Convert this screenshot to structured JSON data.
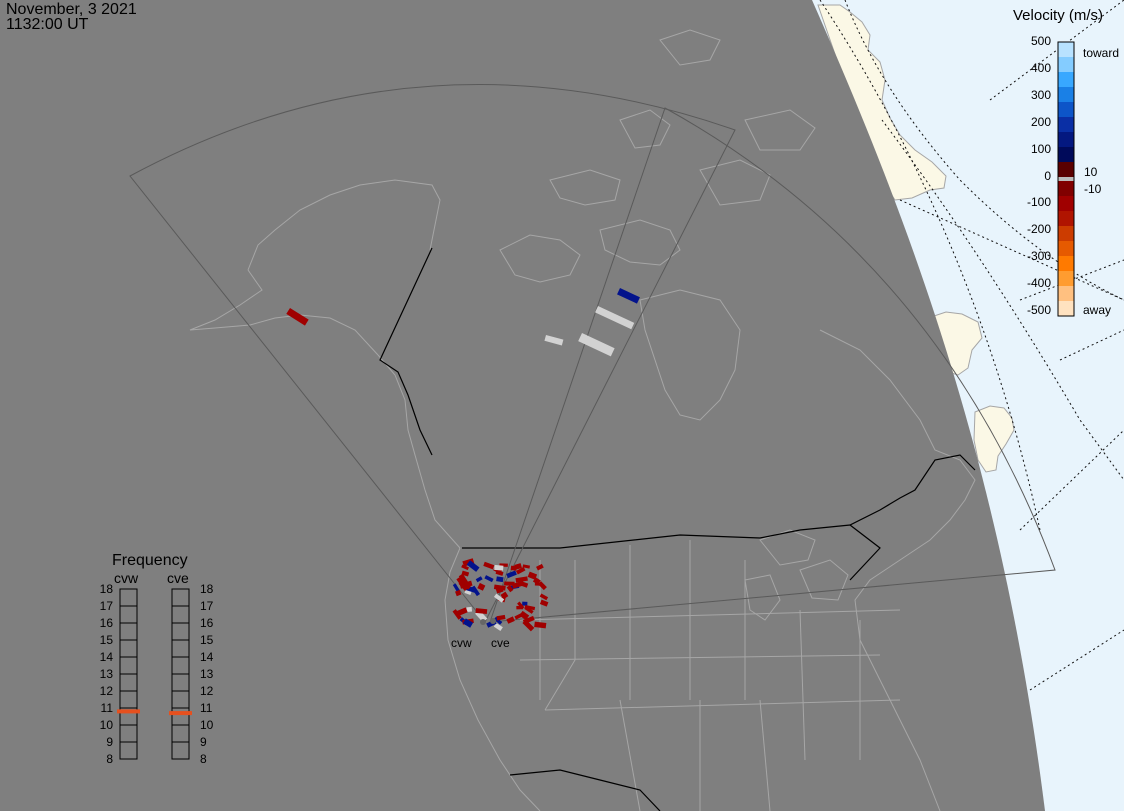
{
  "header": {
    "date": "November, 3 2021",
    "time": "1132:00 UT"
  },
  "colorbar": {
    "title": "Velocity (m/s)",
    "toward_label": "toward",
    "away_label": "away",
    "ticks": [
      "500",
      "400",
      "300",
      "200",
      "100",
      "0",
      "-100",
      "-200",
      "-300",
      "-400",
      "-500"
    ],
    "small_pos": "10",
    "small_neg": "-10",
    "colors": [
      "#b8e2ff",
      "#84ccff",
      "#38a8ff",
      "#1a80e6",
      "#0d55c8",
      "#0a2fa5",
      "#041880",
      "#000a5a",
      "#5a0000",
      "#800000",
      "#a00000",
      "#b01400",
      "#cc3c00",
      "#e65a00",
      "#ff7a00",
      "#ff9c30",
      "#ffc080",
      "#ffe2c0"
    ],
    "gs_color": "#bbbbbb"
  },
  "frequency": {
    "title": "Frequency",
    "radars": [
      "cvw",
      "cve"
    ],
    "levels": [
      "18",
      "17",
      "16",
      "15",
      "14",
      "13",
      "12",
      "11",
      "10",
      "9",
      "8"
    ],
    "cvw_value": 10.8,
    "cve_value": 10.7,
    "marker_color": "#e6501e"
  },
  "stations": {
    "west_label": "cvw",
    "east_label": "cve"
  },
  "colors": {
    "map_background": "#7f7f7f",
    "ocean_background": "#e8f4fc",
    "land_outside": "#fbf8e6",
    "coastline": "#a6a6a6",
    "border": "#000000",
    "fov": "#5a5a5a",
    "toward": "#03138c",
    "away": "#a00000",
    "ground_scatter": "#d2d2d2"
  }
}
